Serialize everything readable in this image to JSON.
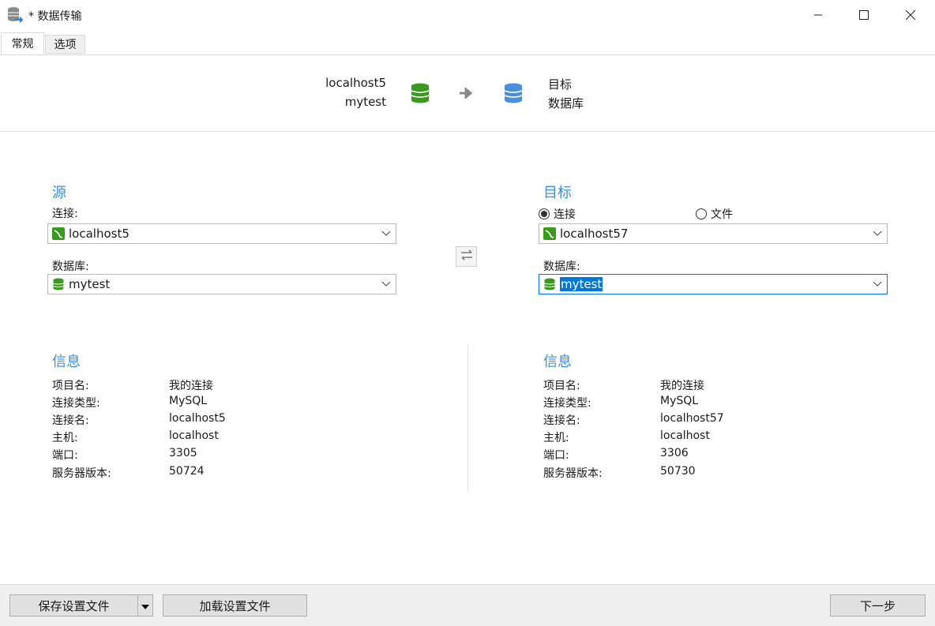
{
  "window": {
    "title": "* 数据传输"
  },
  "tabs": [
    {
      "label": "常规"
    },
    {
      "label": "选项"
    }
  ],
  "header": {
    "source_connection": "localhost5",
    "source_database": "mytest",
    "target_line1": "目标",
    "target_line2": "数据库",
    "source_color": "#3a9a1f",
    "target_color": "#4a90d9"
  },
  "source": {
    "title": "源",
    "connection_label": "连接:",
    "connection_value": "localhost5",
    "database_label": "数据库:",
    "database_value": "mytest"
  },
  "target": {
    "title": "目标",
    "radio_connection": "连接",
    "radio_file": "文件",
    "connection_value": "localhost57",
    "database_label": "数据库:",
    "database_value": "mytest"
  },
  "source_info": {
    "title": "信息",
    "rows": [
      {
        "key": "项目名:",
        "value": "我的连接"
      },
      {
        "key": "连接类型:",
        "value": "MySQL"
      },
      {
        "key": "连接名:",
        "value": "localhost5"
      },
      {
        "key": "主机:",
        "value": "localhost"
      },
      {
        "key": "端口:",
        "value": "3305"
      },
      {
        "key": "服务器版本:",
        "value": "50724"
      }
    ]
  },
  "target_info": {
    "title": "信息",
    "rows": [
      {
        "key": "项目名:",
        "value": "我的连接"
      },
      {
        "key": "连接类型:",
        "value": "MySQL"
      },
      {
        "key": "连接名:",
        "value": "localhost57"
      },
      {
        "key": "主机:",
        "value": "localhost"
      },
      {
        "key": "端口:",
        "value": "3306"
      },
      {
        "key": "服务器版本:",
        "value": "50730"
      }
    ]
  },
  "footer": {
    "save_profile": "保存设置文件",
    "load_profile": "加载设置文件",
    "next": "下一步"
  },
  "colors": {
    "accent": "#3e8fd8",
    "focus": "#0078d7"
  }
}
